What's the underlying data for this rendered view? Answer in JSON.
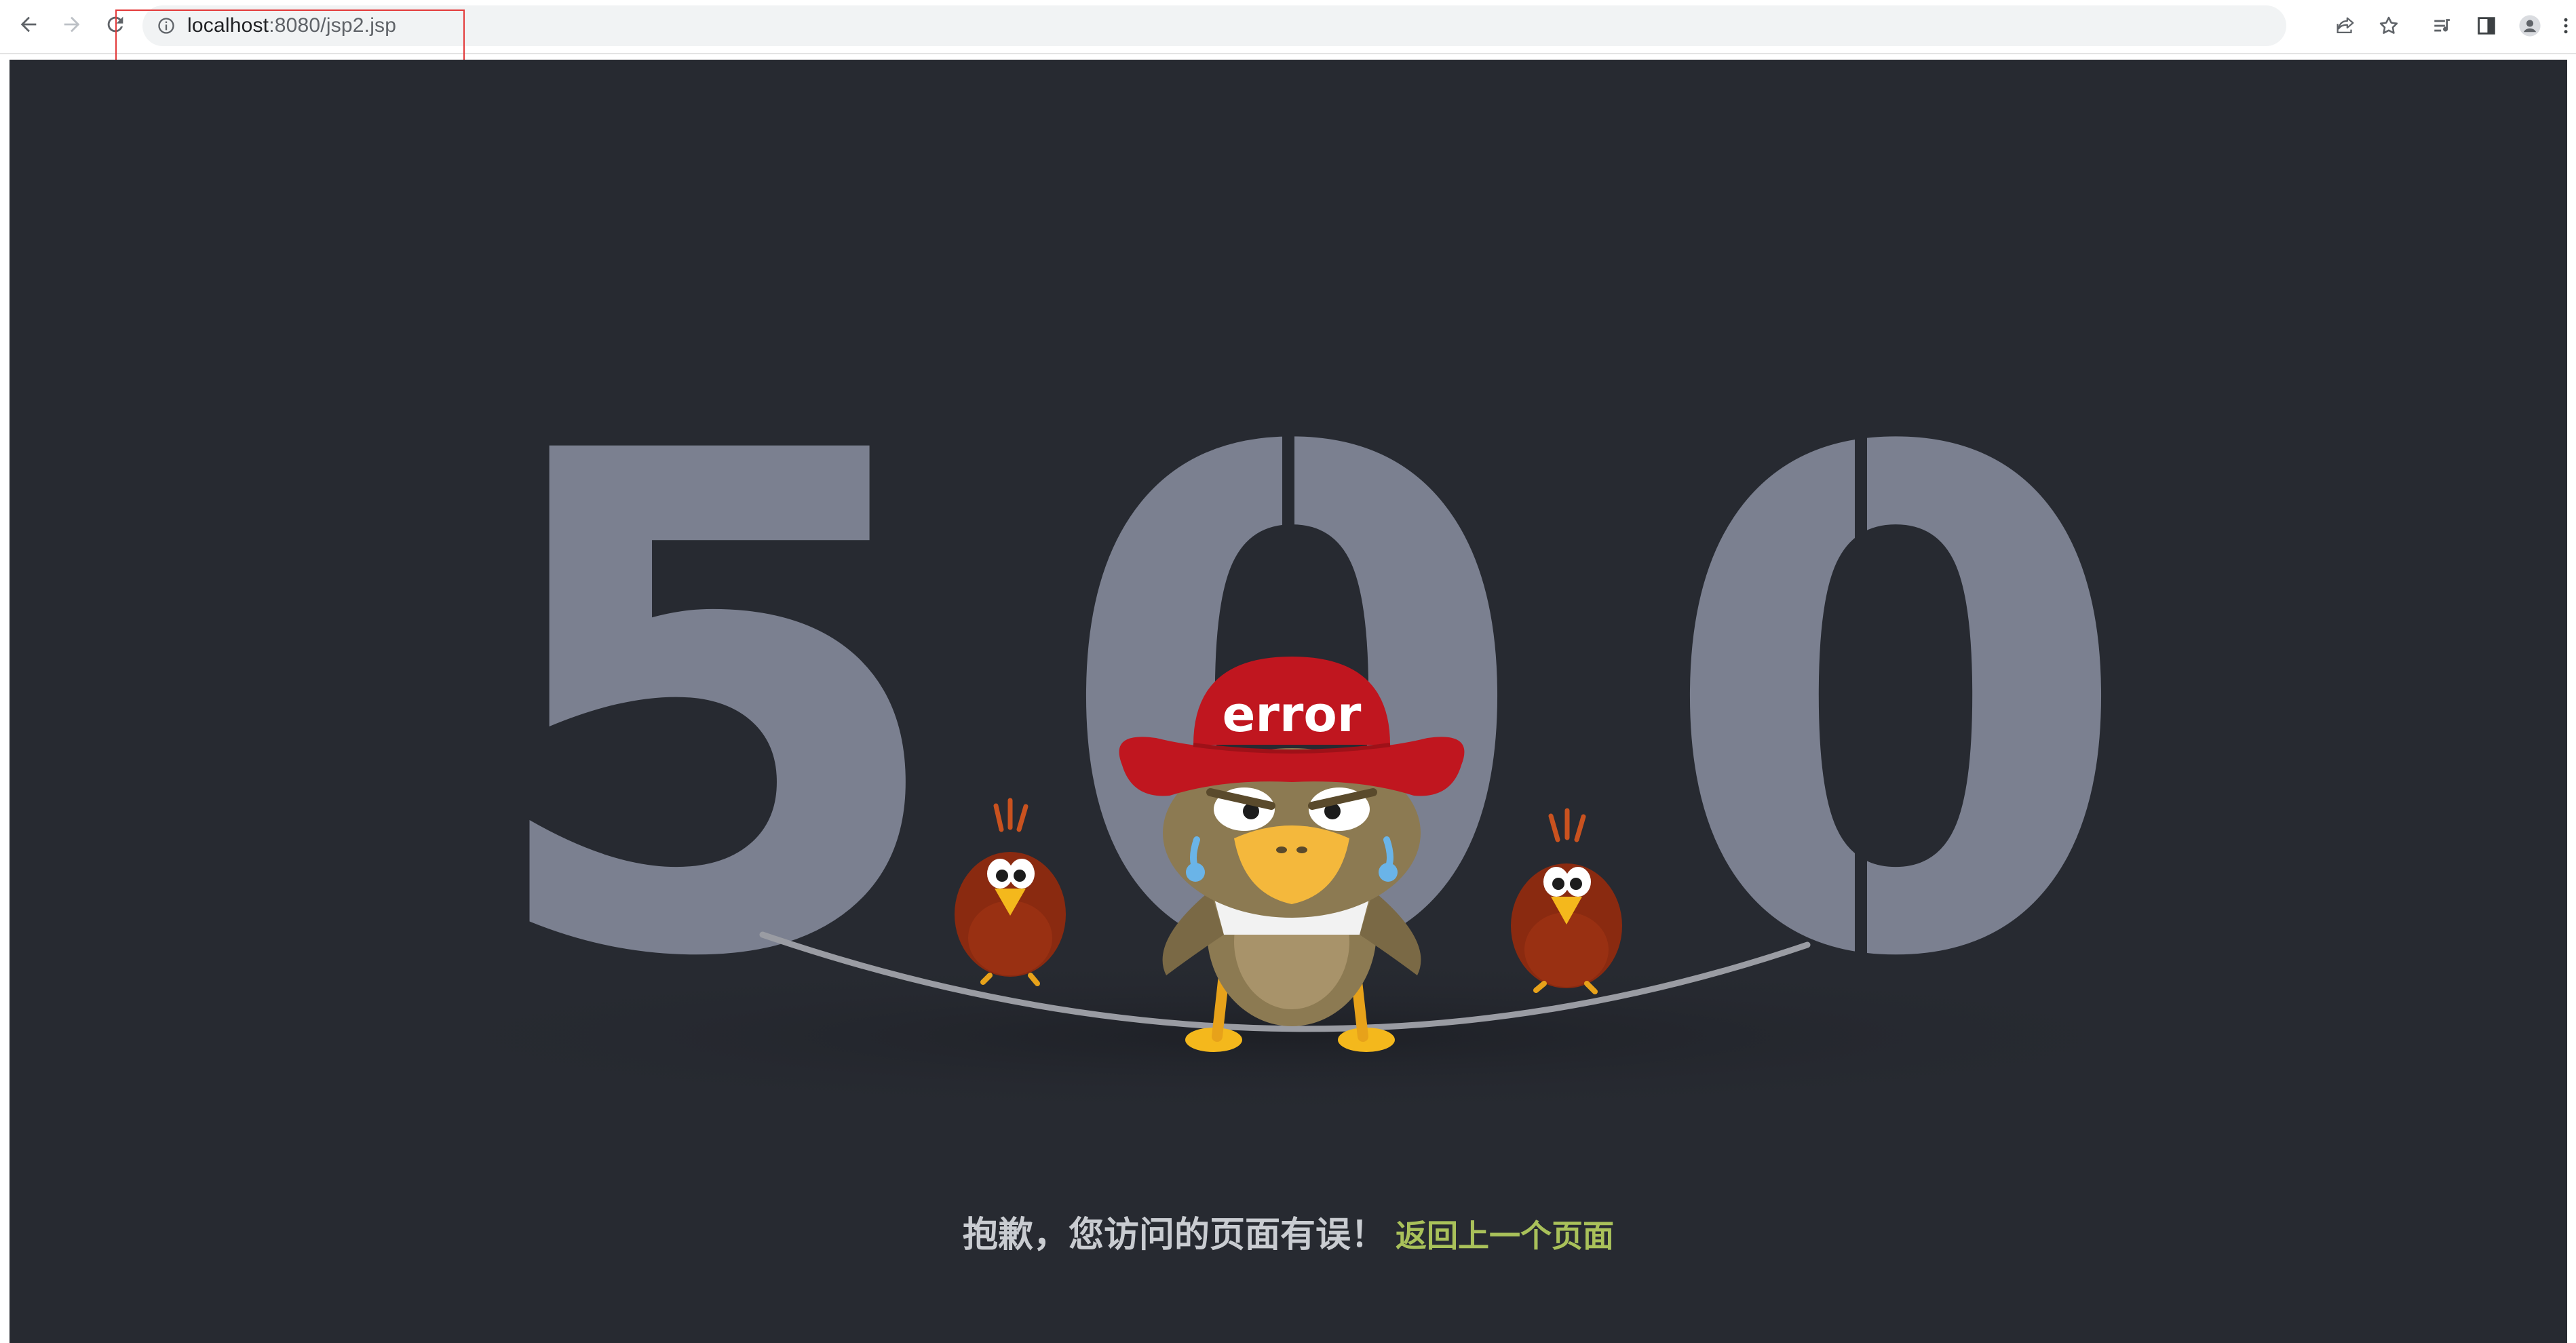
{
  "browser": {
    "url_host": "localhost",
    "url_rest": ":8080/jsp2.jsp",
    "icons": {
      "back": "back-arrow-icon",
      "forward": "forward-arrow-icon",
      "reload": "reload-icon",
      "site_info": "info-icon",
      "share": "share-icon",
      "bookmark": "star-icon",
      "reading_list": "reading-list-icon",
      "side_panel": "side-panel-icon",
      "profile": "profile-icon",
      "menu": "kebab-menu-icon"
    }
  },
  "page": {
    "background_color": "#272a31",
    "digits": [
      "5",
      "0",
      "0"
    ],
    "digit_color": "#7b8090",
    "hat_text": "error",
    "message": "抱歉，您访问的页面有误！",
    "back_link": "返回上一个页面",
    "link_color": "#a9c15a",
    "hat_color": "#c0161f"
  }
}
